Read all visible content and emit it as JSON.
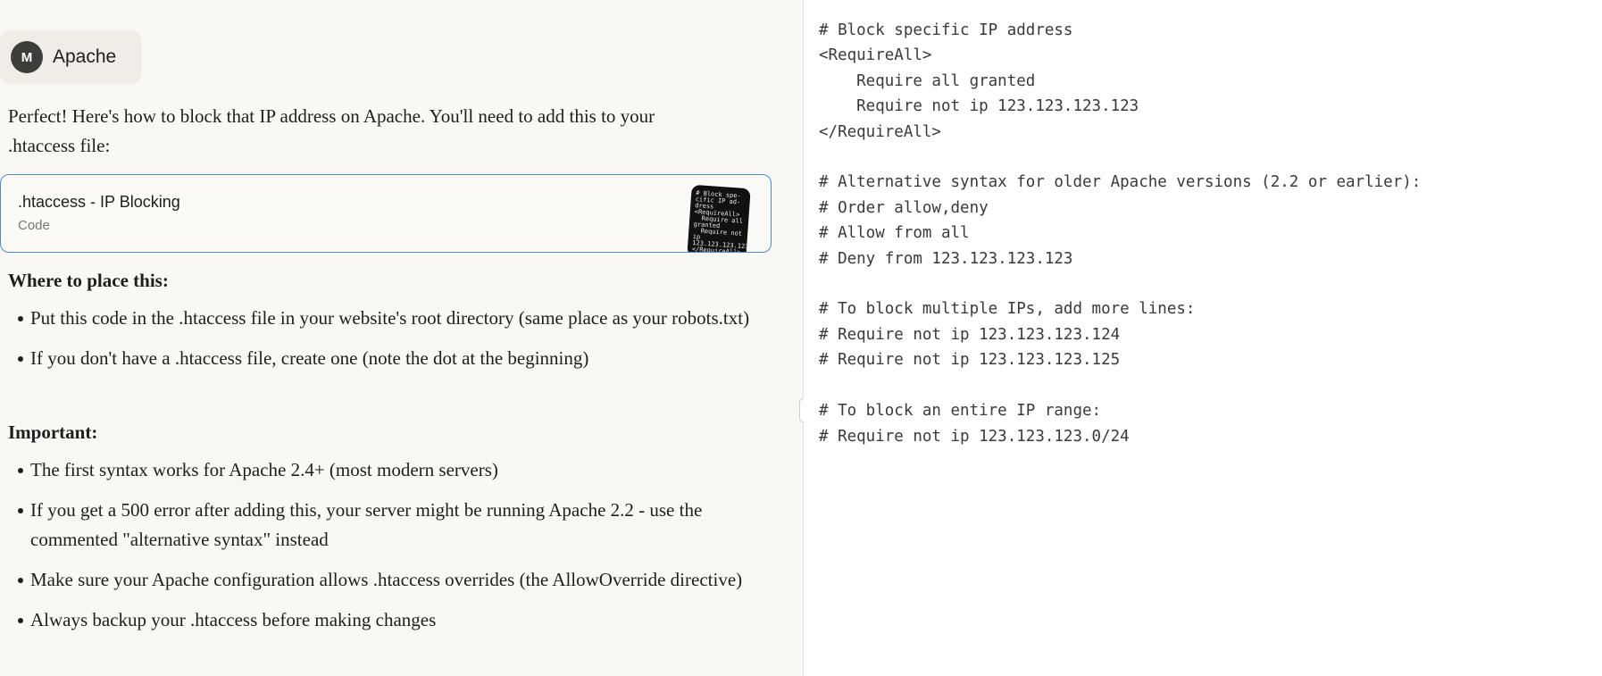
{
  "user_message": {
    "avatar_initial": "M",
    "text": "Apache"
  },
  "assistant": {
    "intro_line1": "Perfect! Here's how to block that IP address on Apache. You'll need to add this to your",
    "intro_line2": ".htaccess file:",
    "artifact": {
      "title": ".htaccess - IP Blocking",
      "type": "Code",
      "thumb_text": "# Block spe-\ncific IP ad-\ndress\n<RequireAll>\n  Require all\ngranted\n  Require not\nip\n123.123.123.123\n</RequireAll>"
    },
    "sections": [
      {
        "heading": "Where to place this:",
        "items": [
          "Put this code in the .htaccess file in your website's root directory (same place as your robots.txt)",
          "If you don't have a .htaccess file, create one (note the dot at the beginning)"
        ]
      },
      {
        "heading": "Important:",
        "items": [
          "The first syntax works for Apache 2.4+ (most modern servers)",
          "If you get a 500 error after adding this, your server might be running Apache 2.2 - use the commented \"alternative syntax\" instead",
          "Make sure your Apache configuration allows .htaccess overrides (the AllowOverride directive)",
          "Always backup your .htaccess before making changes"
        ]
      }
    ]
  },
  "code_panel": {
    "code": "# Block specific IP address\n<RequireAll>\n    Require all granted\n    Require not ip 123.123.123.123\n</RequireAll>\n\n# Alternative syntax for older Apache versions (2.2 or earlier):\n# Order allow,deny\n# Allow from all\n# Deny from 123.123.123.123\n\n# To block multiple IPs, add more lines:\n# Require not ip 123.123.123.124\n# Require not ip 123.123.123.125\n\n# To block an entire IP range:\n# Require not ip 123.123.123.0/24"
  }
}
